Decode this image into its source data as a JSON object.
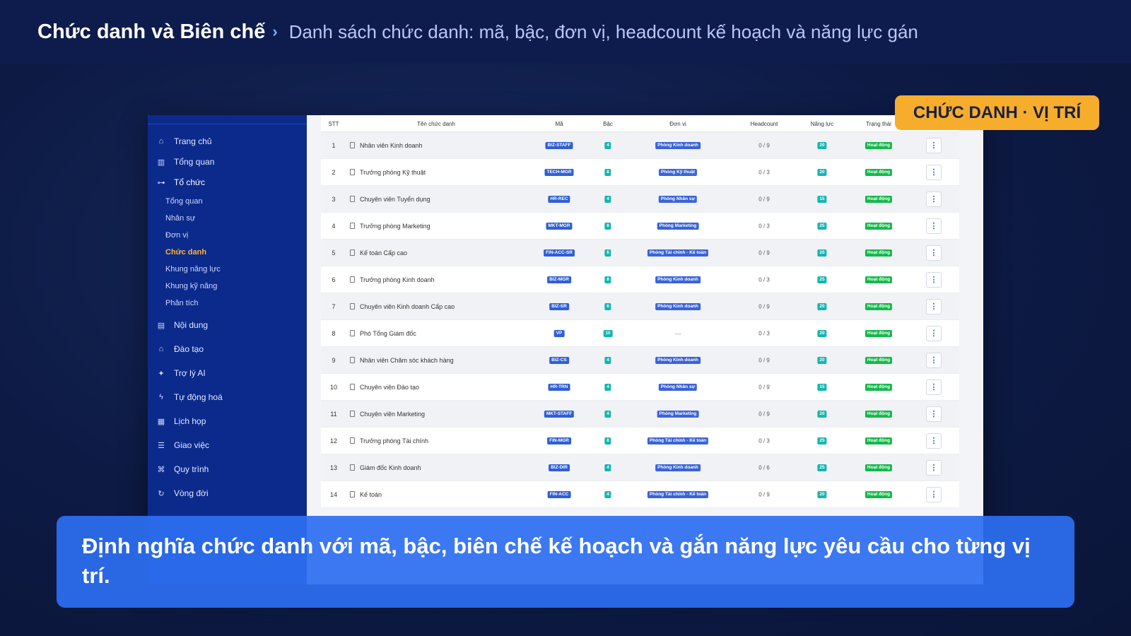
{
  "header": {
    "title": "Chức danh và Biên chế",
    "separator": "›",
    "subtitle": "Danh sách chức danh: mã, bậc, đơn vị, headcount kế hoạch và năng lực gán"
  },
  "tag": "CHỨC DANH · VỊ TRÍ",
  "caption": "Định nghĩa chức danh với mã, bậc, biên chế kế hoạch và gắn năng lực yêu cầu cho từng vị trí.",
  "sidebar": {
    "nav": [
      {
        "label": "Trang chủ",
        "icon": "home-icon",
        "glyph": "⌂"
      },
      {
        "label": "Tổng quan",
        "icon": "bar-chart-icon",
        "glyph": "▥"
      },
      {
        "label": "Tổ chức",
        "icon": "org-chart-icon",
        "glyph": "⊶"
      }
    ],
    "sub": [
      {
        "label": "Tổng quan"
      },
      {
        "label": "Nhân sự"
      },
      {
        "label": "Đơn vị"
      },
      {
        "label": "Chức danh"
      },
      {
        "label": "Khung năng lực"
      },
      {
        "label": "Khung kỹ năng"
      },
      {
        "label": "Phân tích"
      }
    ],
    "nav2": [
      {
        "label": "Nội dung",
        "icon": "book-icon",
        "glyph": "▤"
      },
      {
        "label": "Đào tạo",
        "icon": "graduation-cap-icon",
        "glyph": "⌂"
      },
      {
        "label": "Trợ lý AI",
        "icon": "sparkle-icon",
        "glyph": "✦"
      },
      {
        "label": "Tự động hoá",
        "icon": "lightning-icon",
        "glyph": "ϟ"
      },
      {
        "label": "Lịch họp",
        "icon": "calendar-icon",
        "glyph": "▦"
      },
      {
        "label": "Giao việc",
        "icon": "task-list-icon",
        "glyph": "☰"
      },
      {
        "label": "Quy trình",
        "icon": "workflow-icon",
        "glyph": "⌘"
      },
      {
        "label": "Vòng đời",
        "icon": "cycle-icon",
        "glyph": "↻"
      }
    ]
  },
  "table": {
    "headers": {
      "stt": "STT",
      "name": "Tên chức danh",
      "code": "Mã",
      "grade": "Bậc",
      "dept": "Đơn vị",
      "headcount": "Headcount",
      "capability": "Năng lực",
      "status": "Trạng thái"
    },
    "rows": [
      {
        "stt": "1",
        "name": "Nhân viên Kinh doanh",
        "code": "BIZ-STAFF",
        "grade": "4",
        "dept": "Phòng Kinh doanh",
        "headcount": "0 / 9",
        "capability": "20",
        "status": "Hoạt động"
      },
      {
        "stt": "2",
        "name": "Trưởng phòng Kỹ thuật",
        "code": "TECH-MGR",
        "grade": "8",
        "dept": "Phòng Kỹ thuật",
        "headcount": "0 / 3",
        "capability": "20",
        "status": "Hoạt động"
      },
      {
        "stt": "3",
        "name": "Chuyên viên Tuyển dụng",
        "code": "HR-REC",
        "grade": "4",
        "dept": "Phòng Nhân sự",
        "headcount": "0 / 9",
        "capability": "15",
        "status": "Hoạt động"
      },
      {
        "stt": "4",
        "name": "Trưởng phòng Marketing",
        "code": "MKT-MGR",
        "grade": "8",
        "dept": "Phòng Marketing",
        "headcount": "0 / 3",
        "capability": "25",
        "status": "Hoạt động"
      },
      {
        "stt": "5",
        "name": "Kế toán Cấp cao",
        "code": "FIN-ACC-SR",
        "grade": "6",
        "dept": "Phòng Tài chính - Kế toán",
        "headcount": "0 / 9",
        "capability": "20",
        "status": "Hoạt động"
      },
      {
        "stt": "6",
        "name": "Trưởng phòng Kinh doanh",
        "code": "BIZ-MGR",
        "grade": "8",
        "dept": "Phòng Kinh doanh",
        "headcount": "0 / 3",
        "capability": "25",
        "status": "Hoạt động"
      },
      {
        "stt": "7",
        "name": "Chuyên viên Kinh doanh Cấp cao",
        "code": "BIZ-SR",
        "grade": "6",
        "dept": "Phòng Kinh doanh",
        "headcount": "0 / 9",
        "capability": "20",
        "status": "Hoạt động"
      },
      {
        "stt": "8",
        "name": "Phó Tổng Giám đốc",
        "code": "VP",
        "grade": "10",
        "dept": "—",
        "headcount": "0 / 3",
        "capability": "20",
        "status": "Hoạt động"
      },
      {
        "stt": "9",
        "name": "Nhân viên Chăm sóc khách hàng",
        "code": "BIZ-CS",
        "grade": "4",
        "dept": "Phòng Kinh doanh",
        "headcount": "0 / 9",
        "capability": "20",
        "status": "Hoạt động"
      },
      {
        "stt": "10",
        "name": "Chuyên viên Đào tạo",
        "code": "HR-TRN",
        "grade": "4",
        "dept": "Phòng Nhân sự",
        "headcount": "0 / 9",
        "capability": "15",
        "status": "Hoạt động"
      },
      {
        "stt": "11",
        "name": "Chuyên viên Marketing",
        "code": "MKT-STAFF",
        "grade": "4",
        "dept": "Phòng Marketing",
        "headcount": "0 / 9",
        "capability": "20",
        "status": "Hoạt động"
      },
      {
        "stt": "12",
        "name": "Trưởng phòng Tài chính",
        "code": "FIN-MGR",
        "grade": "8",
        "dept": "Phòng Tài chính - Kế toán",
        "headcount": "0 / 3",
        "capability": "25",
        "status": "Hoạt động"
      },
      {
        "stt": "13",
        "name": "Giám đốc Kinh doanh",
        "code": "BIZ-DIR",
        "grade": "4",
        "dept": "Phòng Kinh doanh",
        "headcount": "0 / 6",
        "capability": "25",
        "status": "Hoạt động"
      },
      {
        "stt": "14",
        "name": "Kế toán",
        "code": "FIN-ACC",
        "grade": "4",
        "dept": "Phòng Tài chính - Kế toán",
        "headcount": "0 / 9",
        "capability": "20",
        "status": "Hoạt động"
      }
    ],
    "action_glyph": "⋮"
  }
}
